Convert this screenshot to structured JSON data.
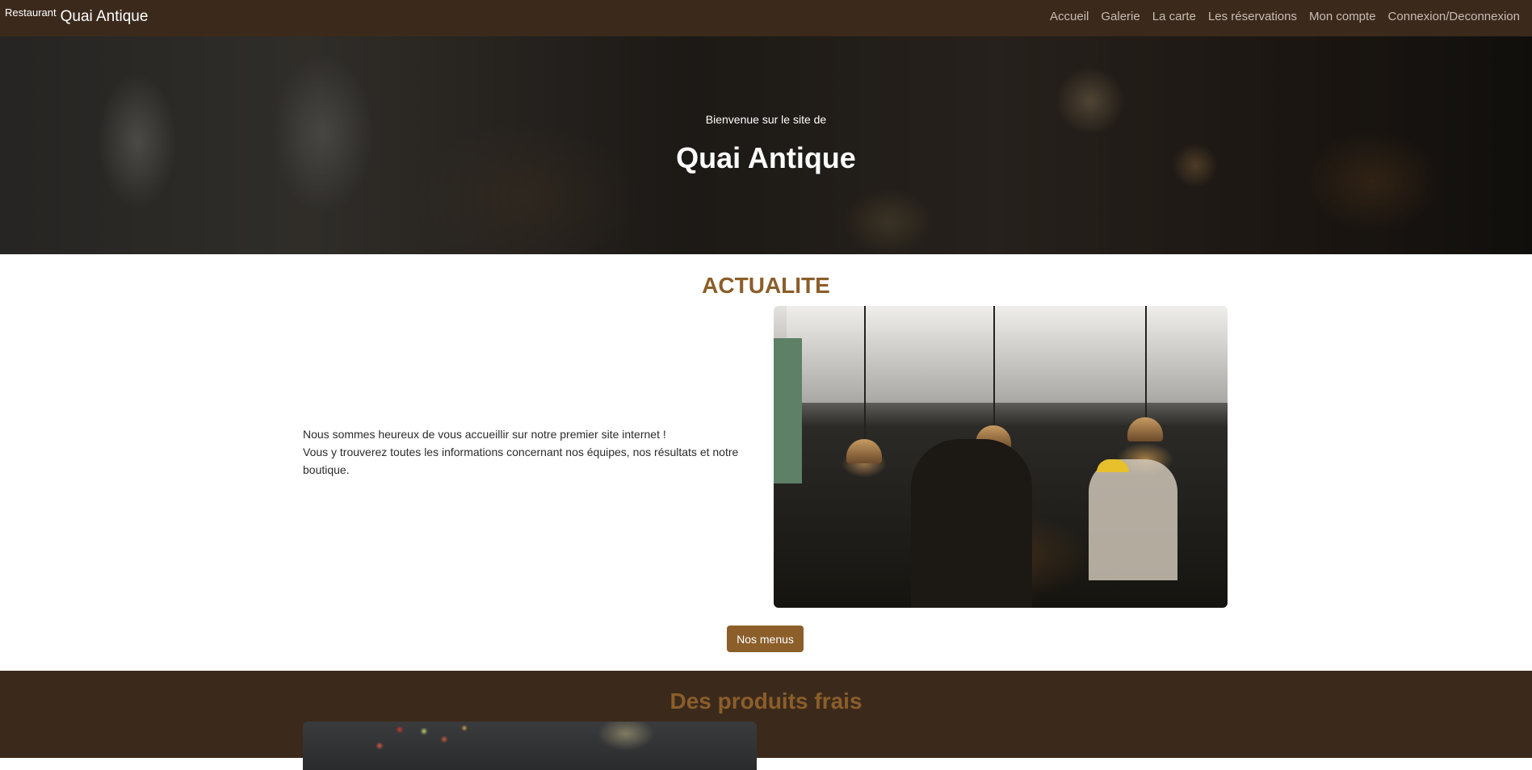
{
  "navbar": {
    "brand_small": "Restaurant",
    "brand_main": "Quai Antique",
    "links": [
      "Accueil",
      "Galerie",
      "La carte",
      "Les réservations",
      "Mon compte",
      "Connexion/Deconnexion"
    ]
  },
  "hero": {
    "subtitle": "Bienvenue sur le site de",
    "title": "Quai Antique"
  },
  "actualite": {
    "title": "ACTUALITE",
    "text_line1": "Nous sommes heureux de vous accueillir sur notre premier site internet !",
    "text_line2": "Vous y trouverez toutes les informations concernant nos équipes, nos résultats et notre boutique.",
    "button": "Nos menus"
  },
  "produits": {
    "title": "Des produits frais"
  },
  "colors": {
    "nav_bg": "#3b2a1c",
    "accent": "#8b5e2a"
  }
}
